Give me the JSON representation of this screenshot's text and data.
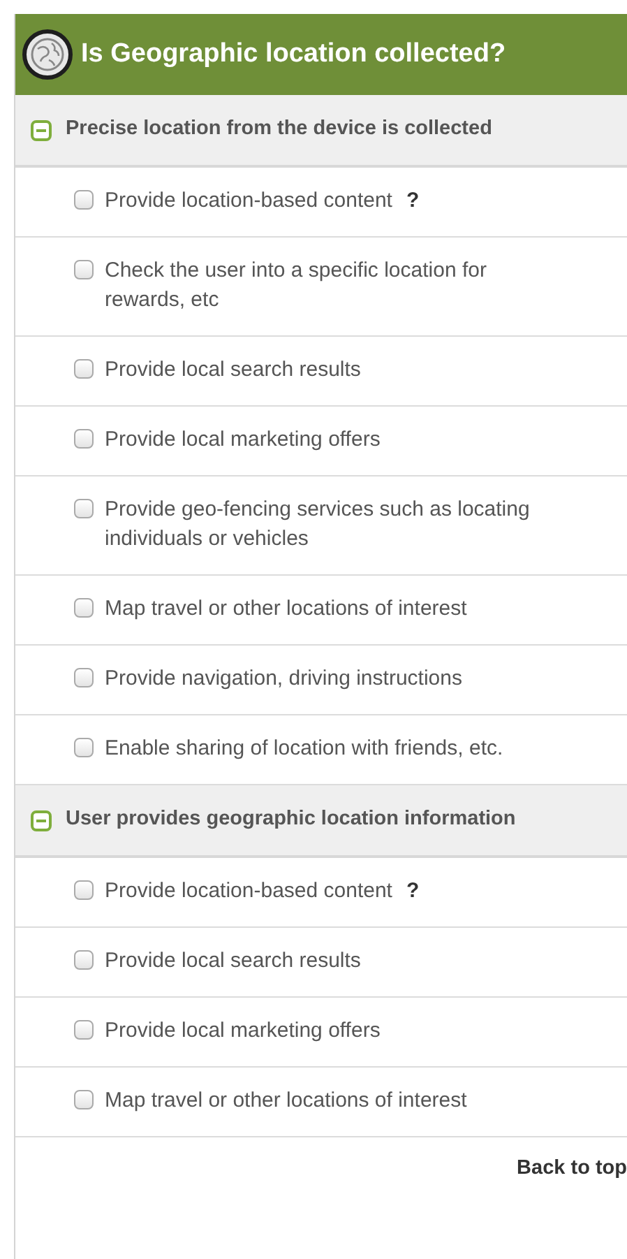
{
  "header": {
    "title": "Is Geographic location collected?"
  },
  "sections": [
    {
      "title": "Precise location from the device is collected",
      "expanded": true,
      "items": [
        {
          "label": "Provide location-based content",
          "help": "?",
          "checked": false
        },
        {
          "label": "Check the user into a specific location for rewards, etc",
          "checked": false
        },
        {
          "label": "Provide local search results",
          "checked": false
        },
        {
          "label": "Provide local marketing offers",
          "checked": false
        },
        {
          "label": "Provide geo-fencing services such as locating individuals or vehicles",
          "checked": false
        },
        {
          "label": "Map travel or other locations of interest",
          "checked": false
        },
        {
          "label": "Provide navigation, driving instructions",
          "checked": false
        },
        {
          "label": "Enable sharing of location with friends, etc.",
          "checked": false
        }
      ]
    },
    {
      "title": "User provides geographic location information",
      "expanded": true,
      "items": [
        {
          "label": "Provide location-based content",
          "help": "?",
          "checked": false
        },
        {
          "label": "Provide local search results",
          "checked": false
        },
        {
          "label": "Provide local marketing offers",
          "checked": false
        },
        {
          "label": "Map travel or other locations of interest",
          "checked": false
        }
      ]
    }
  ],
  "footer": {
    "link": "Back to top"
  }
}
